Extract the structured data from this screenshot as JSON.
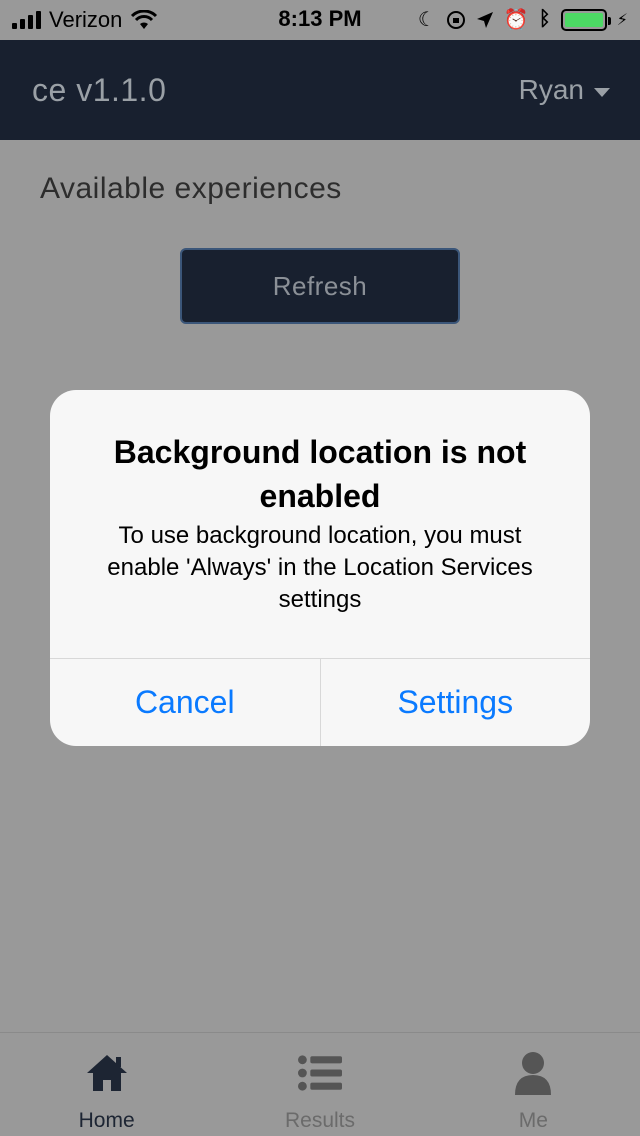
{
  "status_bar": {
    "carrier": "Verizon",
    "time": "8:13 PM",
    "battery_color": "#4cd964"
  },
  "header": {
    "app_title": "ce v1.1.0",
    "user_name": "Ryan",
    "background": "#18202f"
  },
  "main": {
    "section_title": "Available experiences",
    "refresh_label": "Refresh"
  },
  "alert": {
    "title": "Background location is not enabled",
    "message": "To use background location, you must enable 'Always' in the Location Services settings",
    "cancel_label": "Cancel",
    "settings_label": "Settings",
    "button_color": "#0a7aff"
  },
  "tabbar": {
    "items": [
      {
        "label": "Home",
        "icon": "home-icon",
        "active": true
      },
      {
        "label": "Results",
        "icon": "list-icon",
        "active": false
      },
      {
        "label": "Me",
        "icon": "user-icon",
        "active": false
      }
    ]
  }
}
